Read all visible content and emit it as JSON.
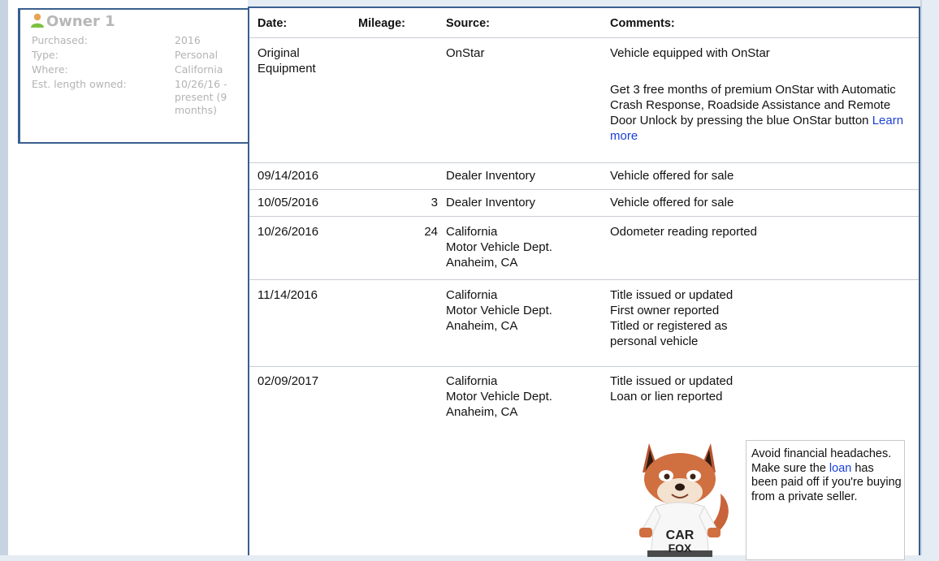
{
  "owner": {
    "title": "Owner 1",
    "rows": [
      {
        "key": "Purchased:",
        "value": "2016"
      },
      {
        "key": "Type:",
        "value": "Personal"
      },
      {
        "key": "Where:",
        "value": "California"
      },
      {
        "key": "Est. length owned:",
        "value": "10/26/16 - present (9 months)"
      }
    ]
  },
  "table": {
    "headers": [
      "Date:",
      "Mileage:",
      "Source:",
      "Comments:"
    ],
    "rows": [
      {
        "date": "Original Equipment",
        "mileage": "",
        "source": "OnStar",
        "comments": [
          "Vehicle equipped with OnStar"
        ],
        "extra": "Get 3 free months of premium OnStar with Automatic Crash Response, Roadside Assistance and Remote Door Unlock by pressing the blue OnStar button",
        "extra_link": "Learn more"
      },
      {
        "date": "09/14/2016",
        "mileage": "",
        "source": "Dealer Inventory",
        "comments": [
          "Vehicle offered for sale"
        ]
      },
      {
        "date": "10/05/2016",
        "mileage": "3",
        "source": "Dealer Inventory",
        "comments": [
          "Vehicle offered for sale"
        ]
      },
      {
        "date": "10/26/2016",
        "mileage": "24",
        "source": "California\nMotor Vehicle Dept.\nAnaheim, CA",
        "comments": [
          "Odometer reading reported"
        ]
      },
      {
        "date": "11/14/2016",
        "mileage": "",
        "source": "California\nMotor Vehicle Dept.\nAnaheim, CA",
        "comments": [
          "Title issued or updated",
          "First owner reported",
          "Titled or registered as personal vehicle"
        ]
      },
      {
        "date": "02/09/2017",
        "mileage": "",
        "source": "California\nMotor Vehicle Dept.\nAnaheim, CA",
        "comments": [
          "Title issued or updated",
          "Loan or lien reported"
        ]
      }
    ]
  },
  "callout": {
    "before": "Avoid financial headaches. Make sure the ",
    "link": "loan",
    "after": " has been paid off if you're buying from a private seller.",
    "shirt_text_1": "CAR",
    "shirt_text_2": "FOX"
  },
  "colors": {
    "frame": "#3a5f8f",
    "link": "#1a3fd6",
    "faded": "#b3b3b3"
  }
}
